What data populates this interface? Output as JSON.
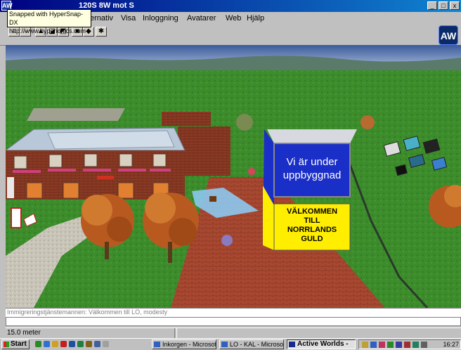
{
  "window": {
    "title": "Active Worlds - LO: 128S 8W mot S",
    "title_visible": "120S 8W mot S",
    "controls": [
      "_",
      "□",
      "x"
    ]
  },
  "snapped_note": {
    "line1": "Snapped with HyperSnap-DX",
    "line2": "http://www.hyperionics.com"
  },
  "menu": {
    "items": [
      "Alternativ",
      "Visa",
      "Inloggning",
      "Avatarer",
      "Web",
      "Hjälp"
    ],
    "visible_first": "ernativ"
  },
  "toolbar": {
    "icons": [
      "back-icon",
      "forward-icon",
      "camera-1-icon",
      "camera-2-icon",
      "camera-3-icon",
      "view-icon",
      "mode-icon",
      "avatar-icon"
    ]
  },
  "logo": {
    "text": "AW"
  },
  "scene": {
    "billboard_line1": "Vi är under",
    "billboard_line2": "uppbyggnad",
    "sign_lines": [
      "VÄLKOMMEN",
      "TILL",
      "NORRLANDS",
      "GULD"
    ]
  },
  "chat": {
    "last_message": "Immigreringstjänstemannen: Välkommen till LO, modesty"
  },
  "status": {
    "distance": "15.0 meter"
  },
  "taskbar": {
    "start_label": "Start",
    "buttons": [
      {
        "label": "Inkorgen - Microsof...",
        "active": false
      },
      {
        "label": "LO - KAL - Microsof...",
        "active": false
      },
      {
        "label": "Active Worlds -",
        "active": true
      }
    ],
    "clock": "16:27"
  },
  "colors": {
    "title_bar": "#000080",
    "billboard_blue": "#1a2ec8",
    "sign_yellow": "#ffee00",
    "grass": "#3c8c2c"
  }
}
